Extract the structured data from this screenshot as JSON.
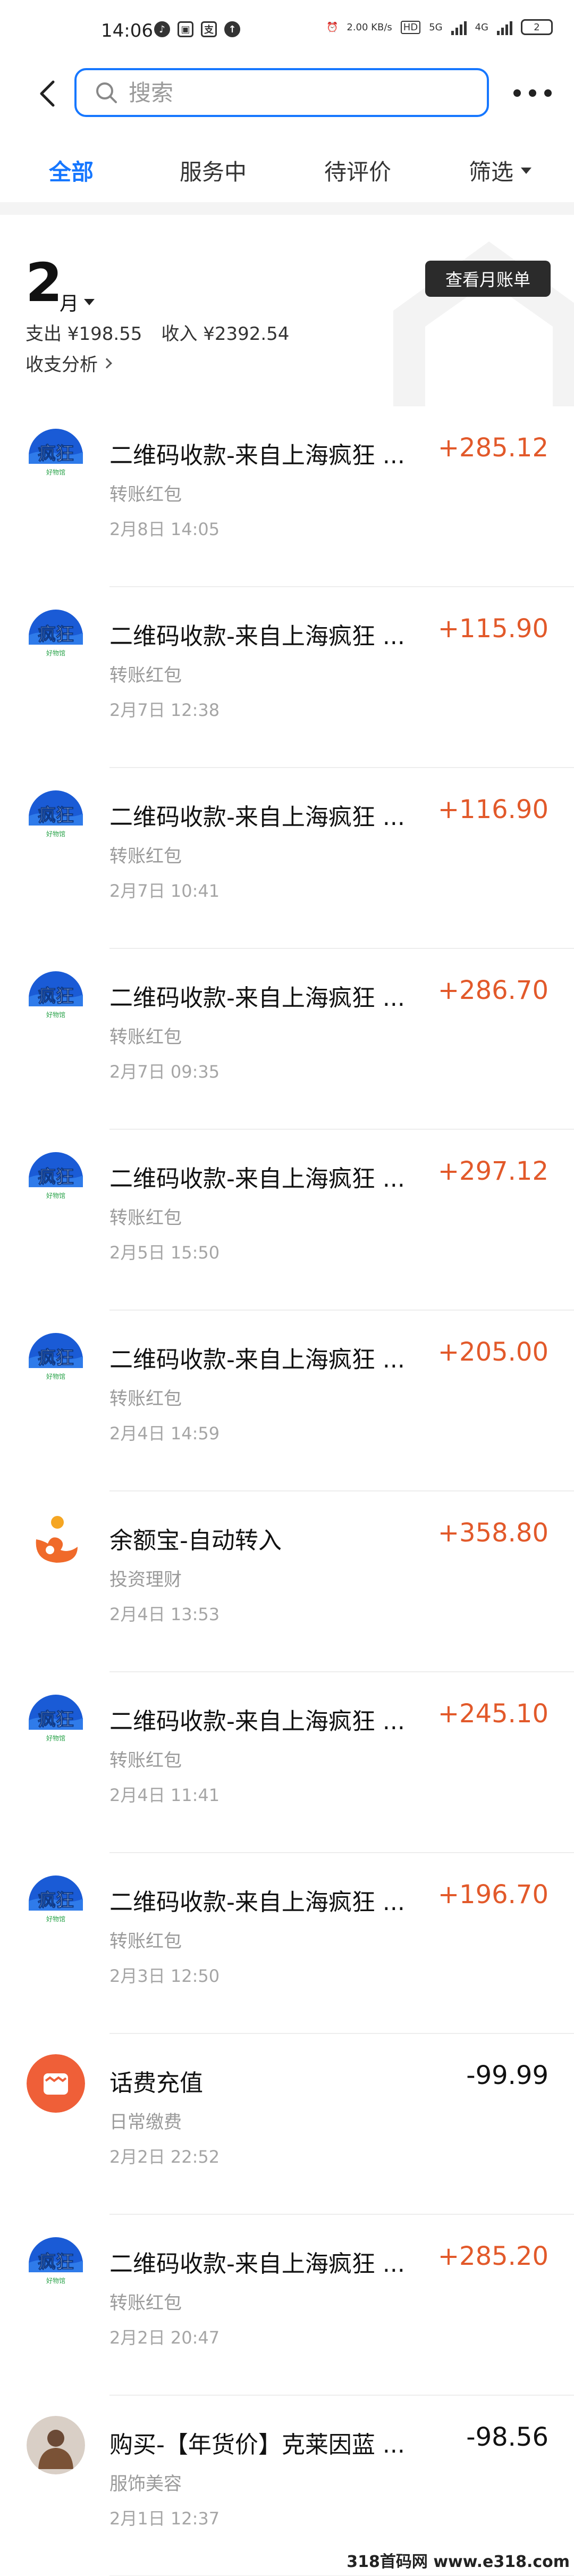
{
  "status_bar": {
    "time": "14:06",
    "net_speed": "2.00 KB/s",
    "network": "5G",
    "network2": "4G",
    "battery": "2"
  },
  "search": {
    "placeholder": "搜索"
  },
  "tabs": [
    {
      "label": "全部",
      "active": true
    },
    {
      "label": "服务中",
      "active": false
    },
    {
      "label": "待评价",
      "active": false
    },
    {
      "label": "筛选",
      "active": false
    }
  ],
  "month": {
    "number": "2",
    "unit": "月",
    "expense": "支出 ¥198.55",
    "income": "收入 ¥2392.54",
    "analysis_label": "收支分析",
    "bill_button": "查看月账单"
  },
  "colors": {
    "accent": "#1677ff",
    "income": "#e2592a",
    "expense": "#111111"
  },
  "transactions": [
    {
      "icon": "crazy-store-logo",
      "title": "二维码收款-来自上海疯狂 ...",
      "category": "转账红包",
      "time": "2月8日 14:05",
      "amount": "+285.12",
      "type": "income"
    },
    {
      "icon": "crazy-store-logo",
      "title": "二维码收款-来自上海疯狂 ...",
      "category": "转账红包",
      "time": "2月7日 12:38",
      "amount": "+115.90",
      "type": "income"
    },
    {
      "icon": "crazy-store-logo",
      "title": "二维码收款-来自上海疯狂 ...",
      "category": "转账红包",
      "time": "2月7日 10:41",
      "amount": "+116.90",
      "type": "income"
    },
    {
      "icon": "crazy-store-logo",
      "title": "二维码收款-来自上海疯狂 ...",
      "category": "转账红包",
      "time": "2月7日 09:35",
      "amount": "+286.70",
      "type": "income"
    },
    {
      "icon": "crazy-store-logo",
      "title": "二维码收款-来自上海疯狂 ...",
      "category": "转账红包",
      "time": "2月5日 15:50",
      "amount": "+297.12",
      "type": "income"
    },
    {
      "icon": "crazy-store-logo",
      "title": "二维码收款-来自上海疯狂 ...",
      "category": "转账红包",
      "time": "2月4日 14:59",
      "amount": "+205.00",
      "type": "income"
    },
    {
      "icon": "yuebao-icon",
      "title": "余额宝-自动转入",
      "category": "投资理财",
      "time": "2月4日 13:53",
      "amount": "+358.80",
      "type": "income"
    },
    {
      "icon": "crazy-store-logo",
      "title": "二维码收款-来自上海疯狂 ...",
      "category": "转账红包",
      "time": "2月4日 11:41",
      "amount": "+245.10",
      "type": "income"
    },
    {
      "icon": "crazy-store-logo",
      "title": "二维码收款-来自上海疯狂 ...",
      "category": "转账红包",
      "time": "2月3日 12:50",
      "amount": "+196.70",
      "type": "income"
    },
    {
      "icon": "phone-bill-icon",
      "title": "话费充值",
      "category": "日常缴费",
      "time": "2月2日 22:52",
      "amount": "-99.99",
      "type": "expense"
    },
    {
      "icon": "crazy-store-logo",
      "title": "二维码收款-来自上海疯狂 ...",
      "category": "转账红包",
      "time": "2月2日 20:47",
      "amount": "+285.20",
      "type": "income"
    },
    {
      "icon": "user-avatar",
      "title": "购买-【年货价】克莱因蓝 ...",
      "category": "服饰美容",
      "time": "2月1日 12:37",
      "amount": "-98.56",
      "type": "expense"
    }
  ],
  "logo_text": {
    "crazy": "疯狂",
    "crazy_sub": "好物馆"
  },
  "site_watermark": "318首码网 www.e318.com"
}
